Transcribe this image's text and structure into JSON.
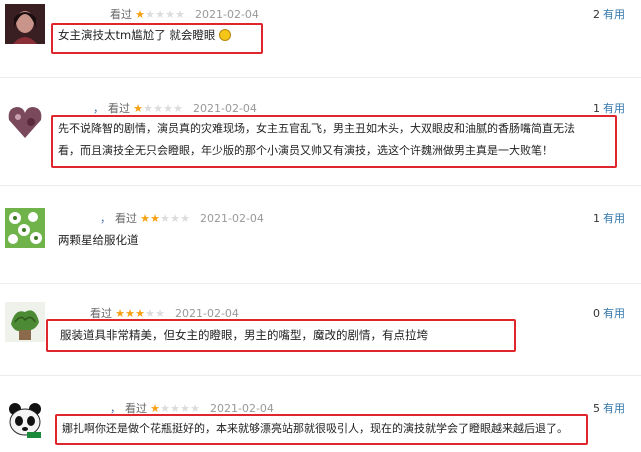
{
  "reviews": [
    {
      "user": "",
      "status": "看过",
      "rating": 1,
      "date": "2021-02-04",
      "votes": "2",
      "votes_label": "有用",
      "text_lines": [
        "女主演技太tm尴尬了 就会瞪眼"
      ],
      "emoji": "grinning-sweat-emoji"
    },
    {
      "user": "，",
      "status": "看过",
      "rating": 1,
      "date": "2021-02-04",
      "votes": "1",
      "votes_label": "有用",
      "text_lines": [
        "先不说降智的剧情，演员真的灾难现场，女主五官乱飞，男主丑如木头，大双眼皮和油腻的香肠嘴简直无法",
        "看，而且演技全无只会瞪眼，年少版的那个小演员又帅又有演技，选这个许魏洲做男主真是一大败笔！"
      ]
    },
    {
      "user": "，",
      "status": "看过",
      "rating": 2,
      "date": "2021-02-04",
      "votes": "1",
      "votes_label": "有用",
      "text_lines": [
        "两颗星给服化道"
      ]
    },
    {
      "user": "",
      "status": "看过",
      "rating": 3,
      "date": "2021-02-04",
      "votes": "0",
      "votes_label": "有用",
      "text_lines": [
        "服装道具非常精美，但女主的瞪眼，男主的嘴型，魔改的剧情，有点拉垮"
      ]
    },
    {
      "user": "，",
      "status": "看过",
      "rating": 1,
      "date": "2021-02-04",
      "votes": "5",
      "votes_label": "有用",
      "text_lines": [
        "娜扎啊你还是做个花瓶挺好的，本来就够漂亮站那就很吸引人，现在的演技就学会了瞪眼越来越后退了。"
      ]
    }
  ],
  "colors": {
    "highlight": "#e0262d",
    "star_on": "#f7a012",
    "star_off": "#dcdcdc",
    "link": "#3377aa"
  }
}
